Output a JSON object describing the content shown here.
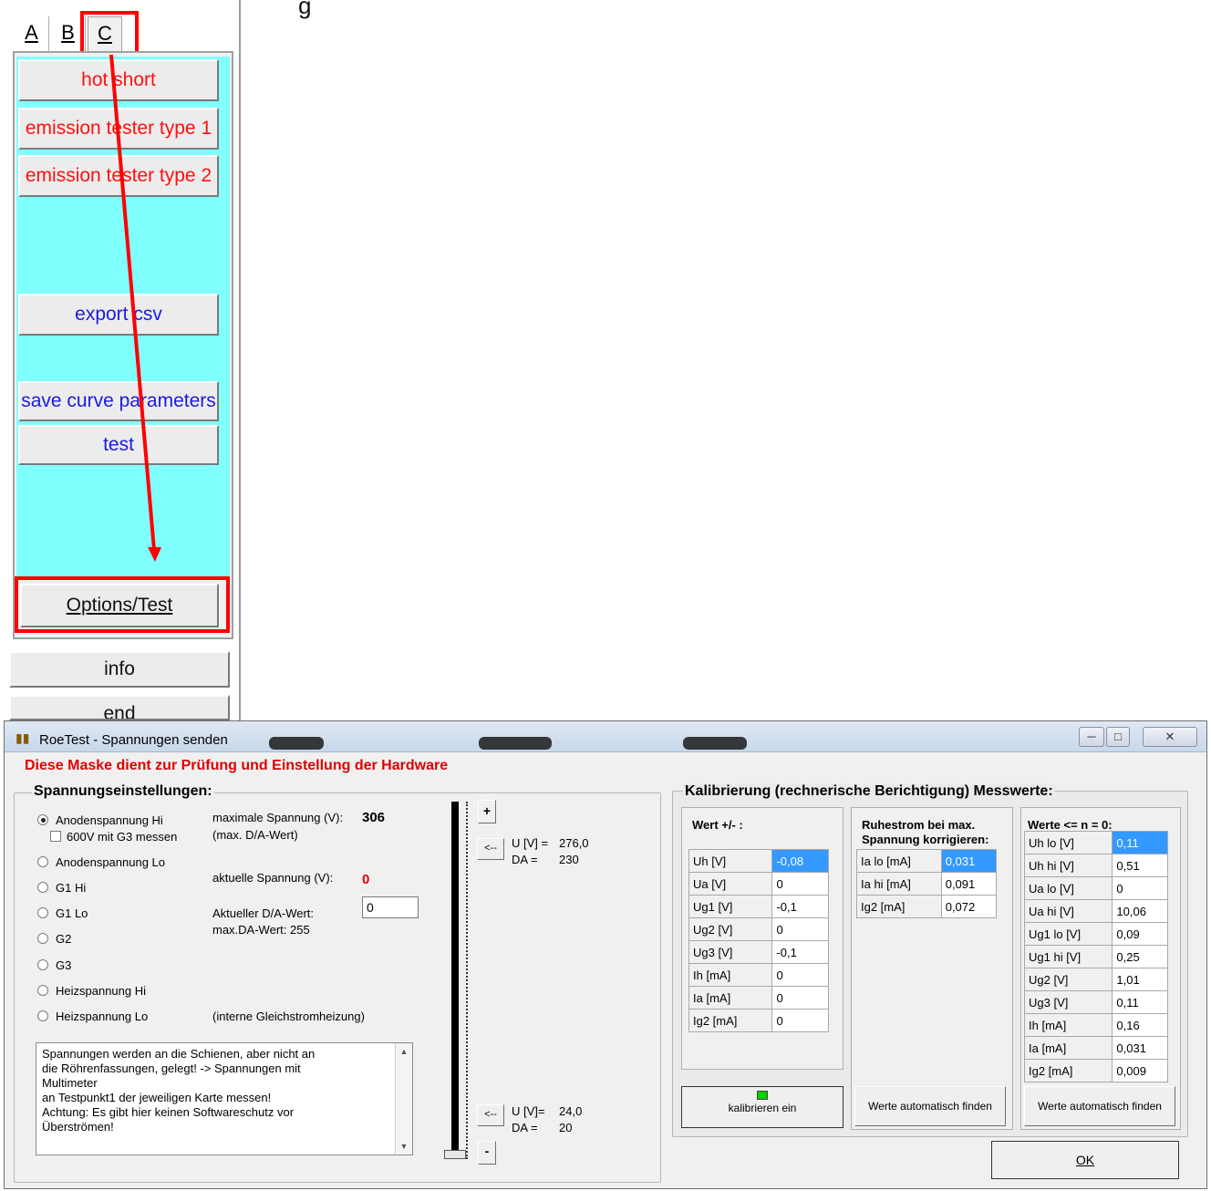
{
  "launcher": {
    "top_fragment": "g",
    "tabs": [
      "A",
      "B",
      "C"
    ],
    "buttons_c": [
      "hot short",
      "emission tester type 1",
      "emission tester type 2",
      "export csv",
      "save curve parameters",
      "test",
      "Options/Test"
    ],
    "info": "info",
    "end": "end"
  },
  "dialog": {
    "title": "RoeTest - Spannungen senden",
    "window_controls": [
      "minimize",
      "maximize",
      "close"
    ],
    "heading": "Diese Maske dient zur Prüfung und Einstellung der Hardware",
    "voltage_group": {
      "title": "Spannungseinstellungen:",
      "radios": [
        "Anodenspannung Hi",
        "Anodenspannung Lo",
        "G1 Hi",
        "G1 Lo",
        "G2",
        "G3",
        "Heizspannung Hi",
        "Heizspannung Lo"
      ],
      "selected": "Anodenspannung Hi",
      "checkbox": "600V mit G3 messen",
      "max_label": "maximale Spannung (V):",
      "max_value": "306",
      "max_da_label": "(max. D/A-Wert)",
      "current_label": "aktuelle Spannung (V):",
      "current_value": "0",
      "da_label": "Aktueller D/A-Wert:",
      "da_max_label": "max.DA-Wert: 255",
      "da_input": "0",
      "heating_note": "(interne Gleichstromheizung)",
      "note": "Spannungen werden an die Schienen, aber nicht an\ndie Röhrenfassungen, gelegt! -> Spannungen mit\nMultimeter\nan Testpunkt1 der jeweiligen Karte messen!\nAchtung: Es gibt hier keinen Softwareschutz vor\nÜberströmen!"
    },
    "slider": {
      "plus": "+",
      "minus": "-",
      "arrow": "<--",
      "upper": {
        "u_label": "U [V] =",
        "u_value": "276,0",
        "da_label": "DA =",
        "da_value": "230"
      },
      "lower": {
        "u_label": "U [V]=",
        "u_value": "24,0",
        "da_label": "DA =",
        "da_value": "20"
      },
      "position_fraction": 0.0
    },
    "calibration": {
      "title": "Kalibrierung (rechnerische Berichtigung) Messwerte:",
      "wert": {
        "title": "Wert +/- :",
        "rows": [
          [
            "Uh   [V]",
            "-0,08"
          ],
          [
            "Ua   [V]",
            "0"
          ],
          [
            "Ug1  [V]",
            "-0,1"
          ],
          [
            "Ug2  [V]",
            "0"
          ],
          [
            "Ug3  [V]",
            "-0,1"
          ],
          [
            "Ih   [mA]",
            "0"
          ],
          [
            "Ia   [mA]",
            "0"
          ],
          [
            "Ig2  [mA]",
            "0"
          ]
        ],
        "selected_row": 0,
        "indicator_color": "#00d000",
        "button": "kalibrieren ein"
      },
      "ruhestrom": {
        "title": "Ruhestrom bei max. Spannung korrigieren:",
        "rows": [
          [
            "Ia lo [mA]",
            "0,031"
          ],
          [
            "Ia hi [mA]",
            "0,091"
          ],
          [
            "Ig2  [mA]",
            "0,072"
          ]
        ],
        "selected_row": 0,
        "button": "Werte automatisch finden"
      },
      "werte_n0": {
        "title": "Werte <= n = 0:",
        "rows": [
          [
            "Uh lo  [V]",
            "0,11"
          ],
          [
            "Uh hi  [V]",
            "0,51"
          ],
          [
            "Ua lo  [V]",
            "0"
          ],
          [
            "Ua hi  [V]",
            "10,06"
          ],
          [
            "Ug1 lo [V]",
            "0,09"
          ],
          [
            "Ug1 hi [V]",
            "0,25"
          ],
          [
            "Ug2    [V]",
            "1,01"
          ],
          [
            "Ug3    [V]",
            "0,11"
          ],
          [
            "Ih     [mA]",
            "0,16"
          ],
          [
            "Ia     [mA]",
            "0,031"
          ],
          [
            "Ig2    [mA]",
            "0,009"
          ]
        ],
        "selected_row": 0,
        "button": "Werte automatisch finden"
      }
    },
    "ok": "OK"
  }
}
